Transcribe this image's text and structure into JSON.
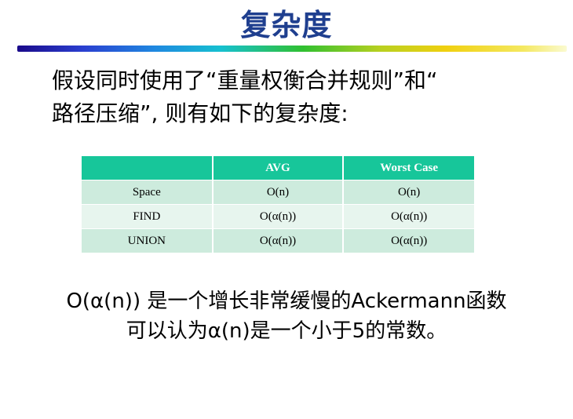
{
  "slide": {
    "title": "复杂度",
    "intro_line1": "假设同时使用了“重量权衡合并规则”和“",
    "intro_line2": "路径压缩”, 则有如下的复杂度:",
    "note_line1": "O(α(n)) 是一个增长非常缓慢的Ackermann函数",
    "note_line2": "可以认为α(n)是一个小于5的常数。"
  },
  "table": {
    "headers": [
      "",
      "AVG",
      "Worst Case"
    ],
    "rows": [
      [
        "Space",
        "O(n)",
        "O(n)"
      ],
      [
        "FIND",
        "O(α(n))",
        "O(α(n))"
      ],
      [
        "UNION",
        "O(α(n))",
        "O(α(n))"
      ]
    ]
  },
  "colors": {
    "title": "#1f3f8f",
    "table_header": "#17c69a",
    "row_dark": "#cdebdd",
    "row_light": "#e7f5ee"
  }
}
